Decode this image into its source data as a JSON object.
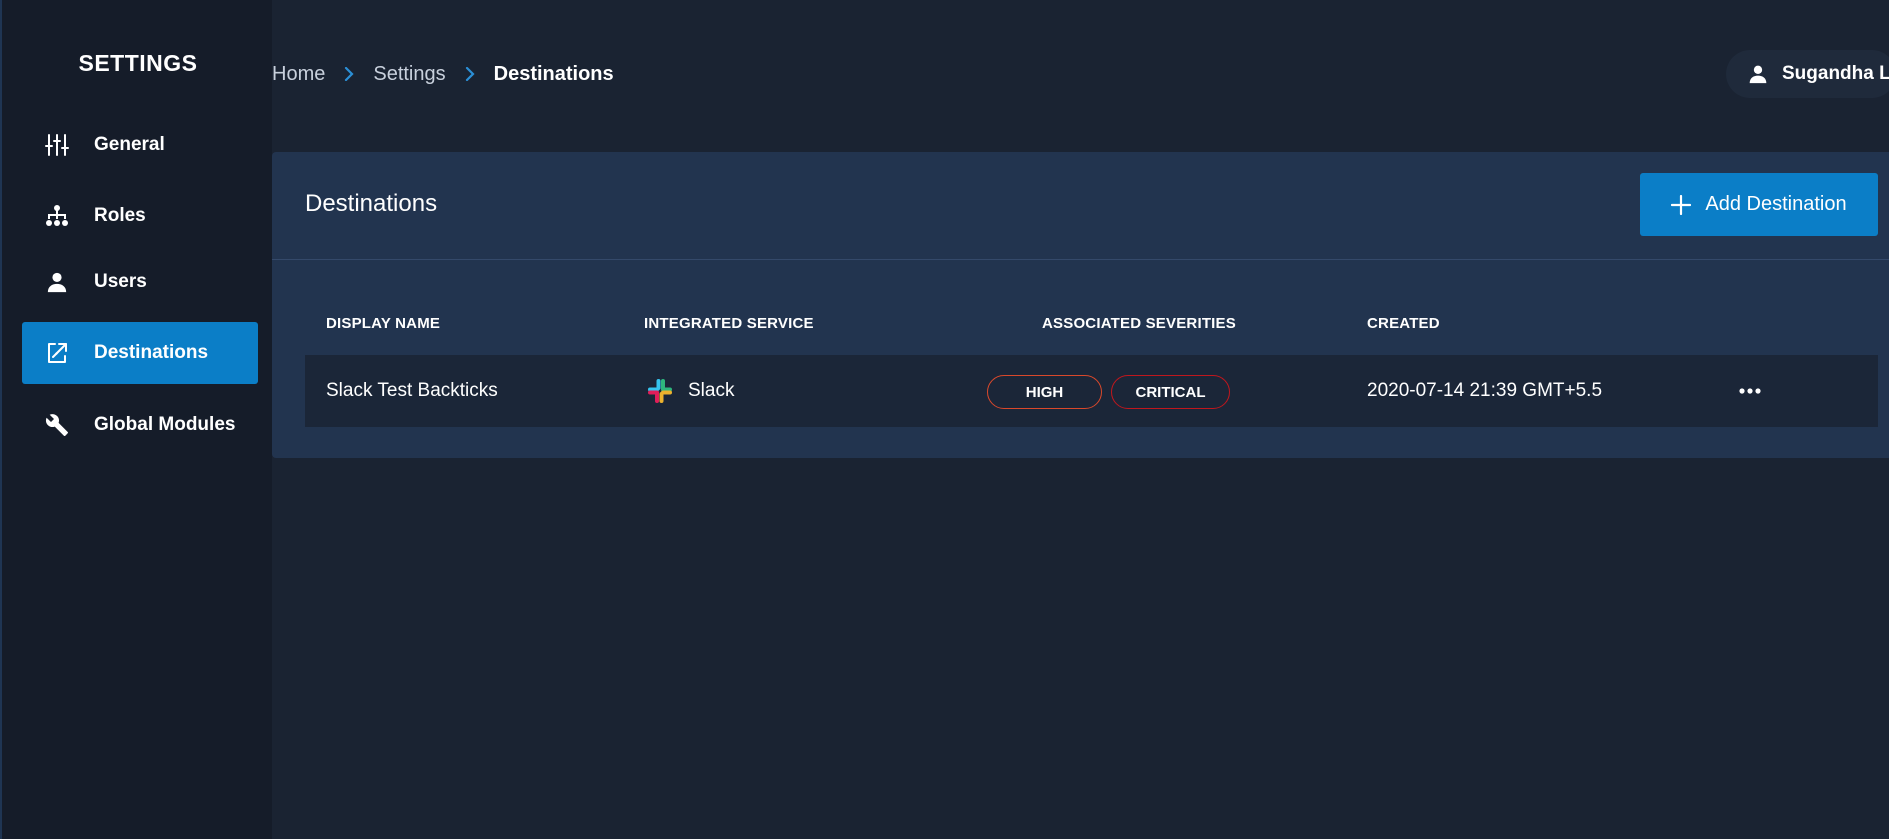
{
  "sidebar": {
    "title": "SETTINGS",
    "items": [
      {
        "label": "General",
        "icon": "sliders-icon"
      },
      {
        "label": "Roles",
        "icon": "hierarchy-icon"
      },
      {
        "label": "Users",
        "icon": "person-icon"
      },
      {
        "label": "Destinations",
        "icon": "share-out-icon",
        "active": true
      },
      {
        "label": "Global Modules",
        "icon": "wrench-icon"
      }
    ]
  },
  "breadcrumb": [
    "Home",
    "Settings",
    "Destinations"
  ],
  "user": {
    "name": "Sugandha L."
  },
  "panel": {
    "title": "Destinations",
    "add_button_label": "Add Destination"
  },
  "table": {
    "columns": [
      "DISPLAY NAME",
      "INTEGRATED SERVICE",
      "ASSOCIATED SEVERITIES",
      "CREATED"
    ],
    "rows": [
      {
        "display_name": "Slack Test Backticks",
        "service": "Slack",
        "severities": [
          "HIGH",
          "CRITICAL"
        ],
        "created": "2020-07-14 21:39 GMT+5.5"
      }
    ]
  },
  "colors": {
    "background": "#1a2332",
    "sidebar": "#151c29",
    "accent": "#0b7ec7",
    "panel": "#22344f",
    "high": "#d9482b",
    "critical": "#c0171d"
  }
}
